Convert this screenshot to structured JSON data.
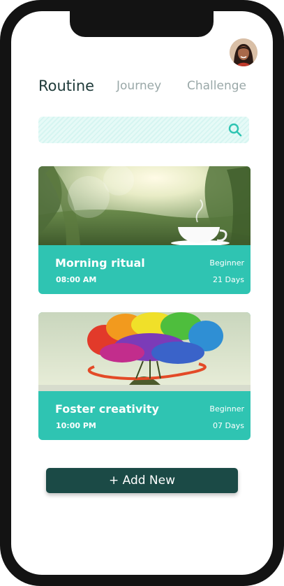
{
  "tabs": [
    "Routine",
    "Journey",
    "Challenge"
  ],
  "search": {
    "value": "",
    "icon": "search-icon"
  },
  "routines": [
    {
      "title": "Morning ritual",
      "time": "08:00 AM",
      "level": "Beginner",
      "duration": "21 Days"
    },
    {
      "title": "Foster creativity",
      "time": "10:00 PM",
      "level": "Beginner",
      "duration": "07 Days"
    }
  ],
  "add_button_label": "+ Add New",
  "colors": {
    "accent": "#2fc4b2",
    "button": "#1b4a46",
    "active_tab": "#1e3a39",
    "inactive_tab": "#9aa8a8"
  }
}
